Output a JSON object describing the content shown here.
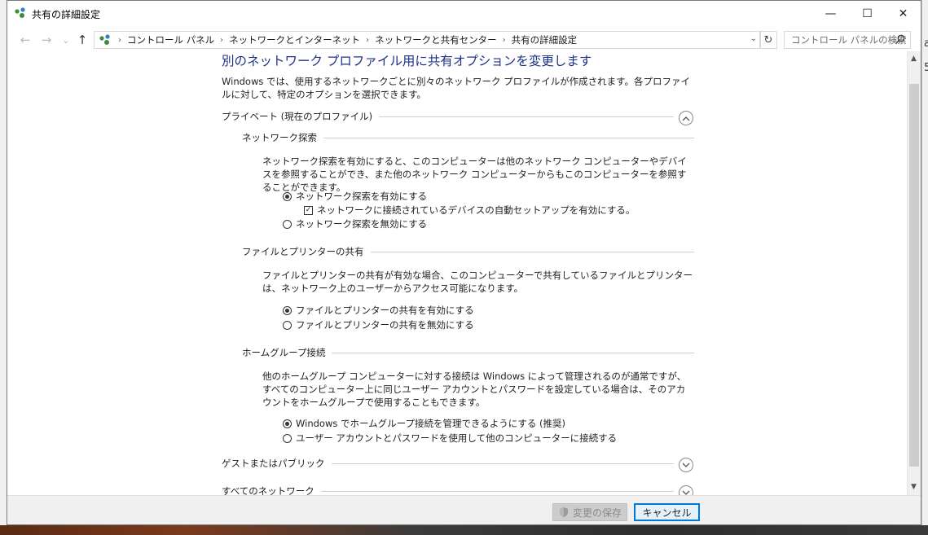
{
  "window": {
    "title": "共有の詳細設定",
    "minimize_glyph": "—",
    "maximize_glyph": "☐",
    "close_glyph": "✕"
  },
  "nav": {
    "back_glyph": "←",
    "forward_glyph": "→",
    "recent_glyph": "⌄",
    "up_glyph": "↑"
  },
  "breadcrumb": {
    "items": [
      "コントロール パネル",
      "ネットワークとインターネット",
      "ネットワークと共有センター",
      "共有の詳細設定"
    ],
    "separator": "›",
    "dropdown_glyph": "⌄",
    "refresh_glyph": "↻"
  },
  "search": {
    "placeholder": "コントロール パネルの検索"
  },
  "page": {
    "heading": "別のネットワーク プロファイル用に共有オプションを変更します",
    "description": "Windows では、使用するネットワークごとに別々のネットワーク プロファイルが作成されます。各プロファイルに対して、特定のオプションを選択できます。"
  },
  "private_profile": {
    "label": "プライベート (現在のプロファイル)",
    "expanded": true,
    "network_discovery": {
      "label": "ネットワーク探索",
      "description": "ネットワーク探索を有効にすると、このコンピューターは他のネットワーク コンピューターやデバイスを参照することができ、また他のネットワーク コンピューターからもこのコンピューターを参照することができます。",
      "option_on": "ネットワーク探索を有効にする",
      "auto_setup": "ネットワークに接続されているデバイスの自動セットアップを有効にする。",
      "option_off": "ネットワーク探索を無効にする"
    },
    "file_printer": {
      "label": "ファイルとプリンターの共有",
      "description": "ファイルとプリンターの共有が有効な場合、このコンピューターで共有しているファイルとプリンターは、ネットワーク上のユーザーからアクセス可能になります。",
      "option_on": "ファイルとプリンターの共有を有効にする",
      "option_off": "ファイルとプリンターの共有を無効にする"
    },
    "homegroup": {
      "label": "ホームグループ接続",
      "description": "他のホームグループ コンピューターに対する接続は Windows によって管理されるのが通常ですが、すべてのコンピューター上に同じユーザー アカウントとパスワードを設定している場合は、そのアカウントをホームグループで使用することもできます。",
      "option_windows": "Windows でホームグループ接続を管理できるようにする (推奨)",
      "option_user": "ユーザー アカウントとパスワードを使用して他のコンピューターに接続する"
    }
  },
  "guest_profile": {
    "label": "ゲストまたはパブリック",
    "expanded": false
  },
  "all_networks": {
    "label": "すべてのネットワーク",
    "expanded": false
  },
  "footer": {
    "save_label": "変更の保存",
    "cancel_label": "キャンセル"
  },
  "background_fragments": [
    "a",
    "5"
  ],
  "colors": {
    "heading": "#1e3287",
    "primary_border": "#0078d7"
  }
}
